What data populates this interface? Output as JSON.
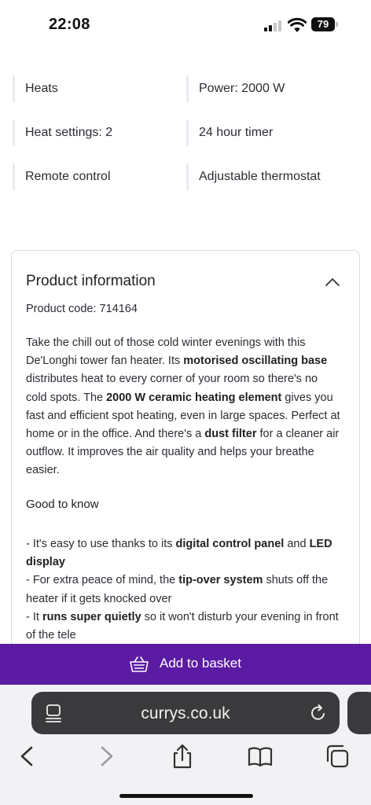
{
  "status_bar": {
    "time": "22:08",
    "battery": "79"
  },
  "features": [
    {
      "label": "Heats"
    },
    {
      "label": "Power: 2000 W"
    },
    {
      "label": "Heat settings: 2"
    },
    {
      "label": "24 hour timer"
    },
    {
      "label": "Remote control"
    },
    {
      "label": "Adjustable thermostat"
    }
  ],
  "product_info": {
    "title": "Product information",
    "code": "Product code: 714164",
    "description": {
      "t1": "Take the chill out of those cold winter evenings with this De'Longhi tower fan heater. Its ",
      "b1": "motorised oscillating base",
      "t2": " distributes heat to every corner of your room so there's no cold spots. The ",
      "b2": "2000 W ceramic heating element",
      "t3": " gives you fast and efficient spot heating, even in large spaces. Perfect at home or in the office. And there's a ",
      "b3": "dust filter",
      "t4": " for a cleaner air outflow. It improves the air quality and helps your breathe easier."
    },
    "good_to_know": "Good to know",
    "bullets": [
      {
        "t1": "- It's easy to use thanks to its ",
        "b1": "digital control panel",
        "t2": " and ",
        "b2": "LED display",
        "t3": ""
      },
      {
        "t1": "- For extra peace of mind, the ",
        "b1": "tip-over system",
        "t2": " shuts off the heater if it gets knocked over",
        "b2": "",
        "t3": ""
      },
      {
        "t1": "- It ",
        "b1": "runs super quietly",
        "t2": " so it won't disturb your evening in front of the tele",
        "b2": "",
        "t3": ""
      }
    ]
  },
  "basket": {
    "label": "Add to basket"
  },
  "browser": {
    "url": "currys.co.uk"
  },
  "colors": {
    "brand_purple": "#5b1ba3",
    "browser_bar": "#3a3a3d"
  },
  "icons": [
    "signal-icon",
    "wifi-icon",
    "chevron-up-icon",
    "basket-icon",
    "page-menu-icon",
    "reload-icon",
    "back-icon",
    "forward-icon",
    "share-icon",
    "bookmarks-icon",
    "tabs-icon"
  ]
}
